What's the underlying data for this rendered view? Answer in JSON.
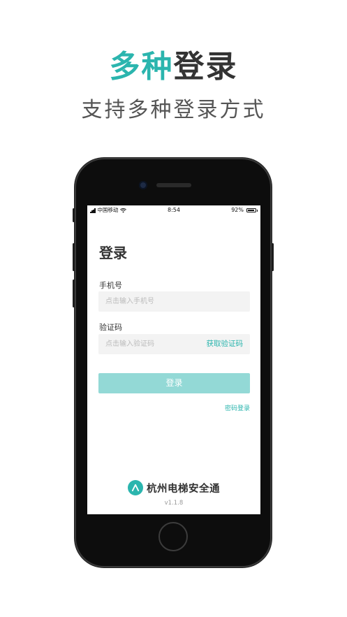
{
  "hero": {
    "title_accent": "多种",
    "title_rest": "登录",
    "subtitle": "支持多种登录方式"
  },
  "status_bar": {
    "carrier": "中国移动",
    "time": "8:54",
    "battery_text": "92%",
    "battery_level": 0.92
  },
  "login": {
    "title": "登录",
    "phone_label": "手机号",
    "phone_placeholder": "点击输入手机号",
    "code_label": "验证码",
    "code_placeholder": "点击输入验证码",
    "get_code_label": "获取验证码",
    "submit_label": "登录",
    "password_login_link": "密码登录"
  },
  "footer": {
    "brand_name": "杭州电梯安全通",
    "version": "v1.1.8"
  },
  "colors": {
    "accent": "#2bb5ae",
    "button_disabled": "#93d9d6"
  },
  "icons": [
    "signal-icon",
    "wifi-icon",
    "battery-icon",
    "brand-logo-icon"
  ]
}
